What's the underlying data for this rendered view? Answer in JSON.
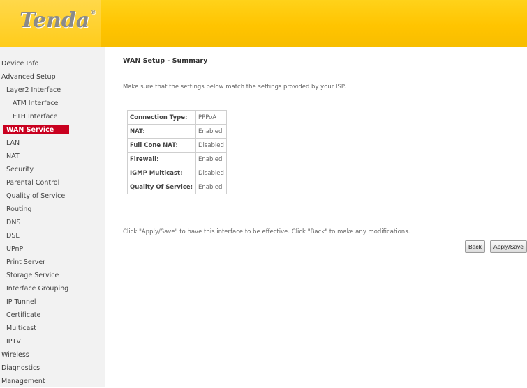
{
  "brand": {
    "logo_text": "Tenda",
    "logo_mark": "®"
  },
  "sidebar": {
    "items": [
      {
        "label": "Device Info",
        "level": 0
      },
      {
        "label": "Advanced Setup",
        "level": 0
      },
      {
        "label": "Layer2 Interface",
        "level": 1
      },
      {
        "label": "ATM Interface",
        "level": 2
      },
      {
        "label": "ETH Interface",
        "level": 2
      },
      {
        "label": "WAN Service",
        "level": 1,
        "active": true
      },
      {
        "label": "LAN",
        "level": 1
      },
      {
        "label": "NAT",
        "level": 1
      },
      {
        "label": "Security",
        "level": 1
      },
      {
        "label": "Parental Control",
        "level": 1
      },
      {
        "label": "Quality of Service",
        "level": 1
      },
      {
        "label": "Routing",
        "level": 1
      },
      {
        "label": "DNS",
        "level": 1
      },
      {
        "label": "DSL",
        "level": 1
      },
      {
        "label": "UPnP",
        "level": 1
      },
      {
        "label": "Print Server",
        "level": 1
      },
      {
        "label": "Storage Service",
        "level": 1
      },
      {
        "label": "Interface Grouping",
        "level": 1
      },
      {
        "label": "IP Tunnel",
        "level": 1
      },
      {
        "label": "Certificate",
        "level": 1
      },
      {
        "label": "Multicast",
        "level": 1
      },
      {
        "label": "IPTV",
        "level": 1
      },
      {
        "label": "Wireless",
        "level": 0
      },
      {
        "label": "Diagnostics",
        "level": 0
      },
      {
        "label": "Management",
        "level": 0
      }
    ]
  },
  "main": {
    "title": "WAN Setup - Summary",
    "intro": "Make sure that the settings below match the settings provided by your ISP.",
    "summary": [
      {
        "key": "Connection Type:",
        "value": "PPPoA"
      },
      {
        "key": "NAT:",
        "value": "Enabled"
      },
      {
        "key": "Full Cone NAT:",
        "value": "Disabled"
      },
      {
        "key": "Firewall:",
        "value": "Enabled"
      },
      {
        "key": "IGMP Multicast:",
        "value": "Disabled"
      },
      {
        "key": "Quality Of Service:",
        "value": "Enabled"
      }
    ],
    "note": "Click \"Apply/Save\" to have this interface to be effective. Click \"Back\" to make any modifications.",
    "back_label": "Back",
    "apply_label": "Apply/Save"
  },
  "colors": {
    "header": "#ffc400",
    "active_nav": "#c9001f",
    "sidebar_bg": "#f2f2f2"
  }
}
